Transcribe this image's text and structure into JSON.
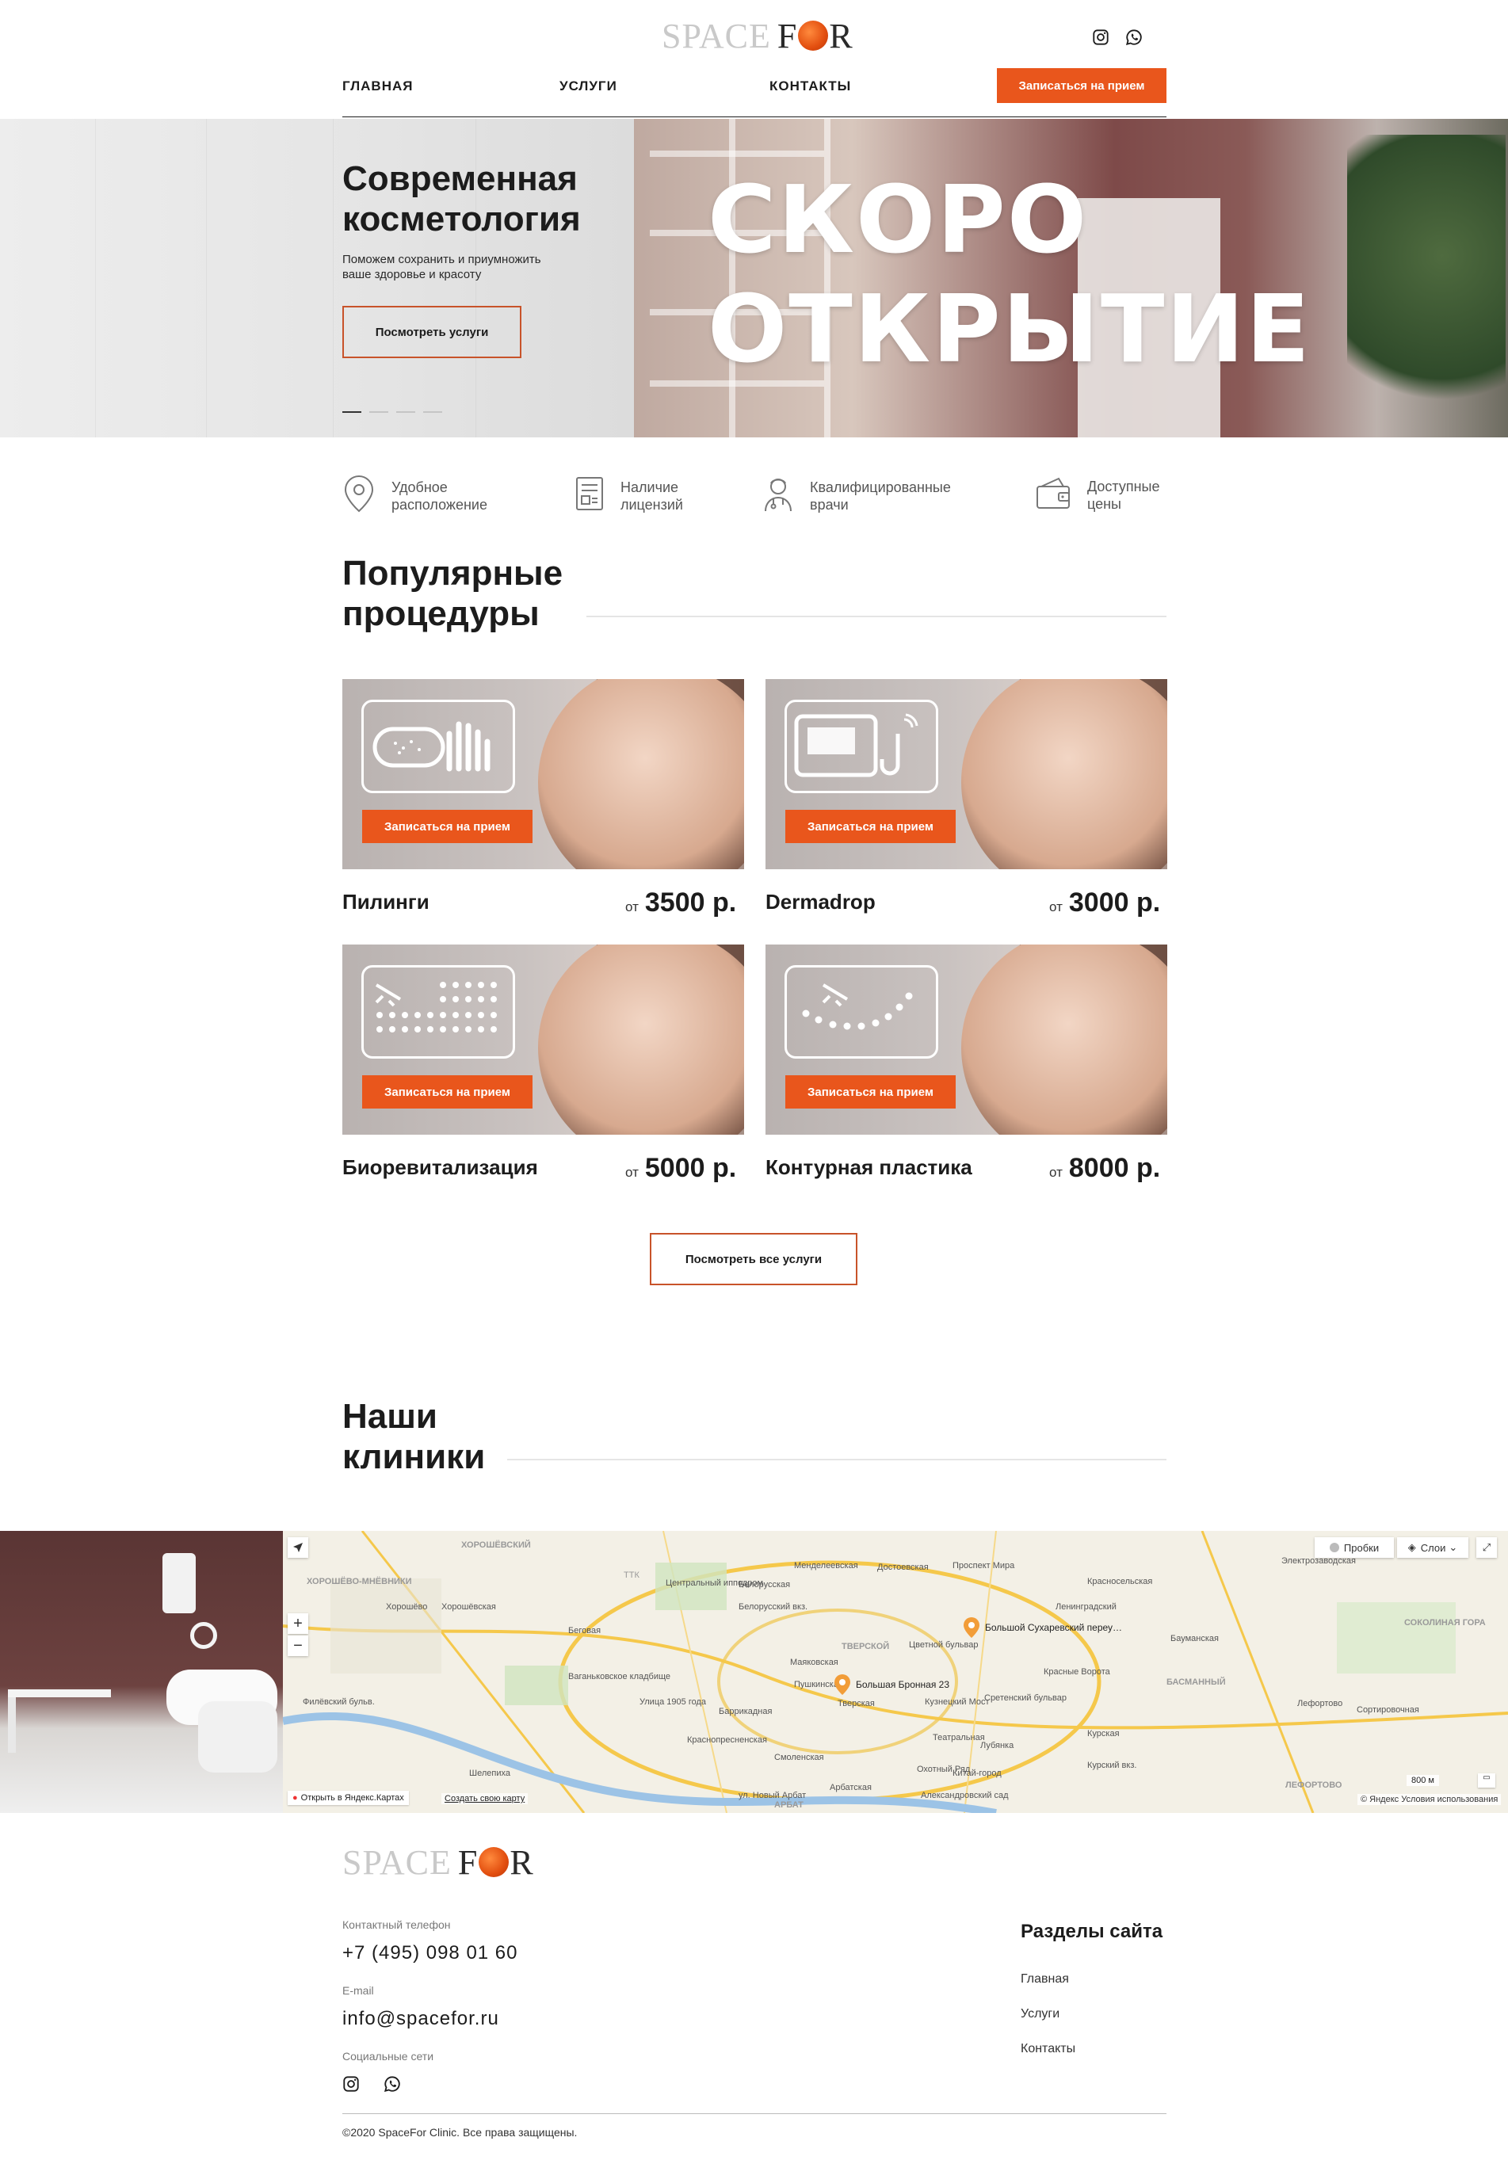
{
  "header": {
    "logo_left": "SPACE",
    "logo_right_f": "F",
    "logo_right_r": "R",
    "nav": [
      "ГЛАВНАЯ",
      "УСЛУГИ",
      "КОНТАКТЫ"
    ],
    "cta": "Записаться на прием",
    "social": [
      "instagram-icon",
      "whatsapp-icon"
    ]
  },
  "hero": {
    "title_line1": "Современная",
    "title_line2": "косметология",
    "subtitle_line1": "Поможем сохранить и приумножить",
    "subtitle_line2": "ваше здоровье и красоту",
    "button": "Посмотреть услуги",
    "banner_line1": "СКОРО",
    "banner_line2": "ОТКРЫТИЕ",
    "slides": 4,
    "active_slide": 1
  },
  "features": [
    {
      "icon": "location-pin-icon",
      "line1": "Удобное",
      "line2": "расположение"
    },
    {
      "icon": "license-document-icon",
      "line1": "Наличие",
      "line2": "лицензий"
    },
    {
      "icon": "doctor-icon",
      "line1": "Квалифицированные",
      "line2": "врачи"
    },
    {
      "icon": "wallet-icon",
      "line1": "Доступные",
      "line2": "цены"
    }
  ],
  "procedures": {
    "title_line1": "Популярные",
    "title_line2": "процедуры",
    "card_button": "Записаться на прием",
    "price_prefix": "от",
    "items": [
      {
        "name": "Пилинги",
        "price": "3500 р.",
        "icon": "peeling-icon"
      },
      {
        "name": "Dermadrop",
        "price": "3000 р.",
        "icon": "dermadrop-device-icon"
      },
      {
        "name": "Биоревитализация",
        "price": "5000 р.",
        "icon": "biorevitalization-icon"
      },
      {
        "name": "Контурная пластика",
        "price": "8000 р.",
        "icon": "contour-plastic-icon"
      }
    ],
    "all_button": "Посмотреть все услуги"
  },
  "clinics": {
    "title_line1": "Наши",
    "title_line2": "клиники"
  },
  "map": {
    "traffic": "Пробки",
    "layers": "Слои",
    "open_link": "Открыть в Яндекс.Картах",
    "create_link": "Создать свою карту",
    "scale": "800 м",
    "copyright": "© Яндекс Условия использования",
    "markers": [
      "Большой Сухаревский переу…",
      "Большая Бронная 23"
    ],
    "labels": [
      "ХОРОШЁВСКИЙ",
      "Хорошёво",
      "Хорошёвская",
      "ХОРОШЁВО-МНЁВНИКИ",
      "Беговая",
      "Белорусская",
      "Менделеевская",
      "Достоевская",
      "Проспект Мира",
      "Красносельская",
      "Ленинградский",
      "Бауманская",
      "Цветной бульвар",
      "Маяковская",
      "Пушкинская",
      "Тверская",
      "Кузнецкий Мост",
      "Сретенский бульвар",
      "Красные Ворота",
      "Курская",
      "Улица 1905 года",
      "Баррикадная",
      "Краснопресненская",
      "Смоленская",
      "Арбатская",
      "Охотный Ряд",
      "Китай-город",
      "Лефортово",
      "Сортировочная",
      "ЛЕФОРТОВО",
      "СОКОЛИНАЯ ГОРА",
      "БАСМАННЫЙ",
      "ТВЕРСКОЙ",
      "ТТК",
      "Ваганьковское кладбище",
      "Филёвский бульв.",
      "Шелепиха",
      "Электрозаводская",
      "Театральная",
      "Лубянка",
      "Александровский сад",
      "ул. Новый Арбат",
      "АРБАТ",
      "Центральный ипподром",
      "Курский вкз.",
      "Белорусский вкз."
    ]
  },
  "footer": {
    "logo_left": "SPACE",
    "logo_right_f": "F",
    "logo_right_r": "R",
    "phone_label": "Контактный телефон",
    "phone": "+7 (495) 098 01 60",
    "email_label": "E-mail",
    "email": "info@spacefor.ru",
    "social_label": "Социальные сети",
    "sections_title": "Разделы сайта",
    "links": [
      "Главная",
      "Услуги",
      "Контакты"
    ],
    "copyright": "©2020 SpaceFor Clinic. Все права защищены."
  },
  "colors": {
    "accent": "#e9561c",
    "outline": "#c8532a",
    "text": "#1c1c1c"
  }
}
